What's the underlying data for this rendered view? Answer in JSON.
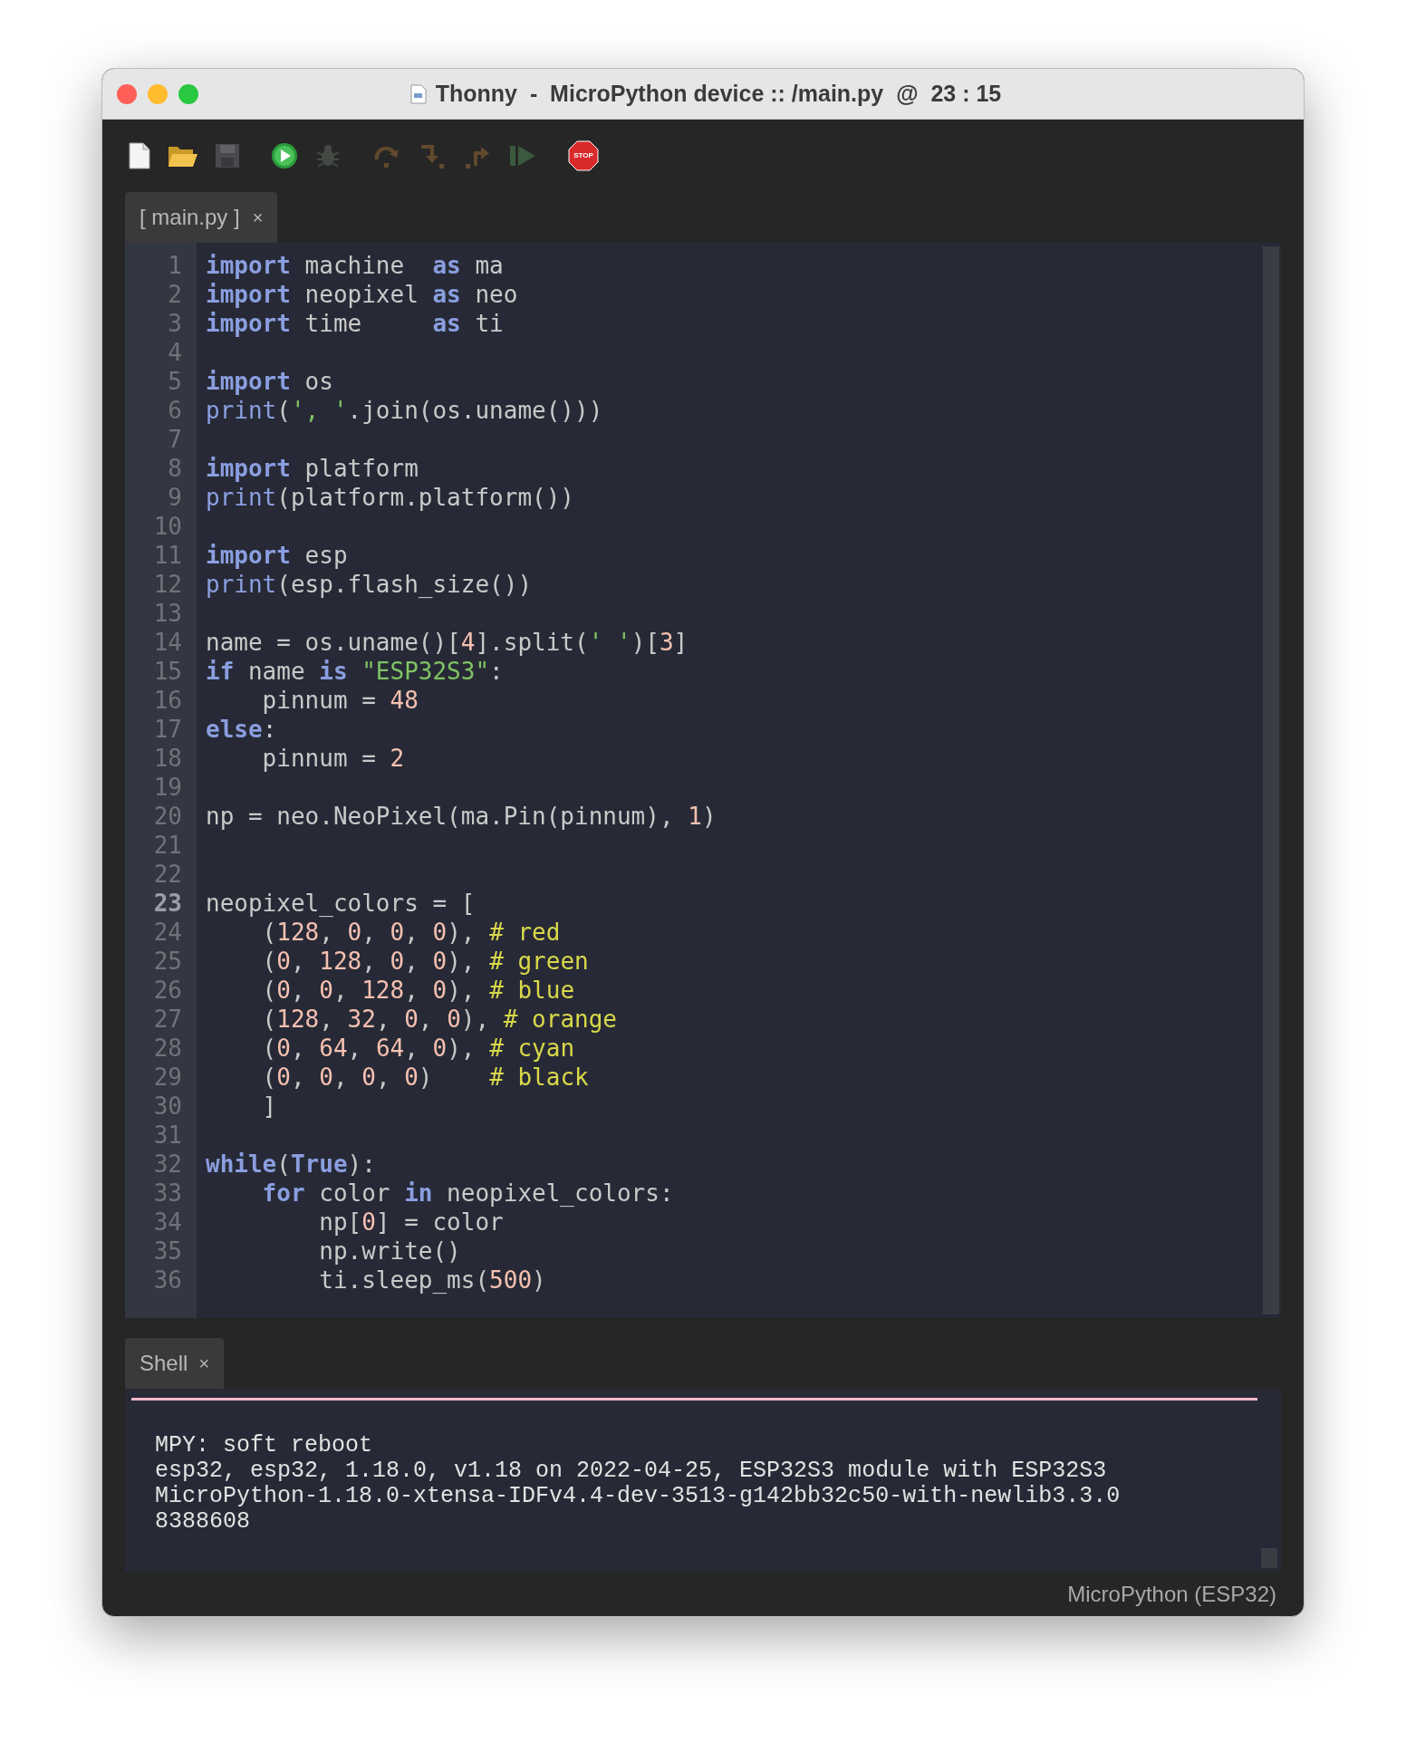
{
  "window": {
    "title": "Thonny  -  MicroPython device :: /main.py  @  23 : 15"
  },
  "toolbar": [
    {
      "kind": "new",
      "disabled": false
    },
    {
      "kind": "open",
      "disabled": false
    },
    {
      "kind": "save",
      "disabled": true
    },
    {
      "kind": "run",
      "disabled": false
    },
    {
      "kind": "debug",
      "disabled": true
    },
    {
      "kind": "step_over",
      "disabled": true
    },
    {
      "kind": "step_into",
      "disabled": true
    },
    {
      "kind": "step_out",
      "disabled": true
    },
    {
      "kind": "resume",
      "disabled": true
    },
    {
      "kind": "stop",
      "disabled": false,
      "label": "STOP"
    }
  ],
  "editor": {
    "tab": {
      "label": "[ main.py ]",
      "close": "×"
    },
    "lines": [
      {
        "number": "1",
        "current": false,
        "tokens": [
          {
            "kind": "keyword",
            "text": "import"
          },
          {
            "kind": "text",
            "text": " machine  "
          },
          {
            "kind": "keyword",
            "text": "as"
          },
          {
            "kind": "text",
            "text": " ma"
          }
        ]
      },
      {
        "number": "2",
        "current": false,
        "tokens": [
          {
            "kind": "keyword",
            "text": "import"
          },
          {
            "kind": "text",
            "text": " neopixel "
          },
          {
            "kind": "keyword",
            "text": "as"
          },
          {
            "kind": "text",
            "text": " neo"
          }
        ]
      },
      {
        "number": "3",
        "current": false,
        "tokens": [
          {
            "kind": "keyword",
            "text": "import"
          },
          {
            "kind": "text",
            "text": " time     "
          },
          {
            "kind": "keyword",
            "text": "as"
          },
          {
            "kind": "text",
            "text": " ti"
          }
        ]
      },
      {
        "number": "4",
        "current": false
      },
      {
        "number": "5",
        "current": false,
        "tokens": [
          {
            "kind": "keyword",
            "text": "import"
          },
          {
            "kind": "text",
            "text": " os"
          }
        ]
      },
      {
        "number": "6",
        "current": false,
        "tokens": [
          {
            "kind": "builtin",
            "text": "print"
          },
          {
            "kind": "text",
            "text": "("
          },
          {
            "kind": "string",
            "text": "', '"
          },
          {
            "kind": "text",
            "text": ".join(os.uname()))"
          }
        ]
      },
      {
        "number": "7",
        "current": false
      },
      {
        "number": "8",
        "current": false,
        "tokens": [
          {
            "kind": "keyword",
            "text": "import"
          },
          {
            "kind": "text",
            "text": " platform"
          }
        ]
      },
      {
        "number": "9",
        "current": false,
        "tokens": [
          {
            "kind": "builtin",
            "text": "print"
          },
          {
            "kind": "text",
            "text": "(platform.platform())"
          }
        ]
      },
      {
        "number": "10",
        "current": false
      },
      {
        "number": "11",
        "current": false,
        "tokens": [
          {
            "kind": "keyword",
            "text": "import"
          },
          {
            "kind": "text",
            "text": " esp"
          }
        ]
      },
      {
        "number": "12",
        "current": false,
        "tokens": [
          {
            "kind": "builtin",
            "text": "print"
          },
          {
            "kind": "text",
            "text": "(esp.flash_size())"
          }
        ]
      },
      {
        "number": "13",
        "current": false
      },
      {
        "number": "14",
        "current": false,
        "tokens": [
          {
            "kind": "text",
            "text": "name = os.uname()["
          },
          {
            "kind": "number",
            "text": "4"
          },
          {
            "kind": "text",
            "text": "].split("
          },
          {
            "kind": "string",
            "text": "' '"
          },
          {
            "kind": "text",
            "text": ")["
          },
          {
            "kind": "number",
            "text": "3"
          },
          {
            "kind": "text",
            "text": "]"
          }
        ]
      },
      {
        "number": "15",
        "current": false,
        "tokens": [
          {
            "kind": "keyword",
            "text": "if"
          },
          {
            "kind": "text",
            "text": " name "
          },
          {
            "kind": "keyword",
            "text": "is "
          },
          {
            "kind": "string",
            "text": "\"ESP32S3\""
          },
          {
            "kind": "text",
            "text": ":"
          }
        ]
      },
      {
        "number": "16",
        "current": false,
        "tokens": [
          {
            "kind": "text",
            "text": "    pinnum = "
          },
          {
            "kind": "number",
            "text": "48"
          }
        ]
      },
      {
        "number": "17",
        "current": false,
        "tokens": [
          {
            "kind": "keyword",
            "text": "else"
          },
          {
            "kind": "text",
            "text": ":"
          }
        ]
      },
      {
        "number": "18",
        "current": false,
        "tokens": [
          {
            "kind": "text",
            "text": "    pinnum = "
          },
          {
            "kind": "number",
            "text": "2"
          }
        ]
      },
      {
        "number": "19",
        "current": false
      },
      {
        "number": "20",
        "current": false,
        "tokens": [
          {
            "kind": "text",
            "text": "np = neo.NeoPixel(ma.Pin(pinnum), "
          },
          {
            "kind": "number",
            "text": "1"
          },
          {
            "kind": "text",
            "text": ")"
          }
        ]
      },
      {
        "number": "21",
        "current": false
      },
      {
        "number": "22",
        "current": false
      },
      {
        "number": "23",
        "current": true,
        "tokens": [
          {
            "kind": "text",
            "text": "neopixel_colors = ["
          }
        ]
      },
      {
        "number": "24",
        "current": false,
        "tokens": [
          {
            "kind": "text",
            "text": "    ("
          },
          {
            "kind": "number",
            "text": "128"
          },
          {
            "kind": "text",
            "text": ", "
          },
          {
            "kind": "number",
            "text": "0"
          },
          {
            "kind": "text",
            "text": ", "
          },
          {
            "kind": "number",
            "text": "0"
          },
          {
            "kind": "text",
            "text": ", "
          },
          {
            "kind": "number",
            "text": "0"
          },
          {
            "kind": "text",
            "text": "), "
          },
          {
            "kind": "comment",
            "text": "# red"
          }
        ]
      },
      {
        "number": "25",
        "current": false,
        "tokens": [
          {
            "kind": "text",
            "text": "    ("
          },
          {
            "kind": "number",
            "text": "0"
          },
          {
            "kind": "text",
            "text": ", "
          },
          {
            "kind": "number",
            "text": "128"
          },
          {
            "kind": "text",
            "text": ", "
          },
          {
            "kind": "number",
            "text": "0"
          },
          {
            "kind": "text",
            "text": ", "
          },
          {
            "kind": "number",
            "text": "0"
          },
          {
            "kind": "text",
            "text": "), "
          },
          {
            "kind": "comment",
            "text": "# green"
          }
        ]
      },
      {
        "number": "26",
        "current": false,
        "tokens": [
          {
            "kind": "text",
            "text": "    ("
          },
          {
            "kind": "number",
            "text": "0"
          },
          {
            "kind": "text",
            "text": ", "
          },
          {
            "kind": "number",
            "text": "0"
          },
          {
            "kind": "text",
            "text": ", "
          },
          {
            "kind": "number",
            "text": "128"
          },
          {
            "kind": "text",
            "text": ", "
          },
          {
            "kind": "number",
            "text": "0"
          },
          {
            "kind": "text",
            "text": "), "
          },
          {
            "kind": "comment",
            "text": "# blue"
          }
        ]
      },
      {
        "number": "27",
        "current": false,
        "tokens": [
          {
            "kind": "text",
            "text": "    ("
          },
          {
            "kind": "number",
            "text": "128"
          },
          {
            "kind": "text",
            "text": ", "
          },
          {
            "kind": "number",
            "text": "32"
          },
          {
            "kind": "text",
            "text": ", "
          },
          {
            "kind": "number",
            "text": "0"
          },
          {
            "kind": "text",
            "text": ", "
          },
          {
            "kind": "number",
            "text": "0"
          },
          {
            "kind": "text",
            "text": "), "
          },
          {
            "kind": "comment",
            "text": "# orange"
          }
        ]
      },
      {
        "number": "28",
        "current": false,
        "tokens": [
          {
            "kind": "text",
            "text": "    ("
          },
          {
            "kind": "number",
            "text": "0"
          },
          {
            "kind": "text",
            "text": ", "
          },
          {
            "kind": "number",
            "text": "64"
          },
          {
            "kind": "text",
            "text": ", "
          },
          {
            "kind": "number",
            "text": "64"
          },
          {
            "kind": "text",
            "text": ", "
          },
          {
            "kind": "number",
            "text": "0"
          },
          {
            "kind": "text",
            "text": "), "
          },
          {
            "kind": "comment",
            "text": "# cyan"
          }
        ]
      },
      {
        "number": "29",
        "current": false,
        "tokens": [
          {
            "kind": "text",
            "text": "    ("
          },
          {
            "kind": "number",
            "text": "0"
          },
          {
            "kind": "text",
            "text": ", "
          },
          {
            "kind": "number",
            "text": "0"
          },
          {
            "kind": "text",
            "text": ", "
          },
          {
            "kind": "number",
            "text": "0"
          },
          {
            "kind": "text",
            "text": ", "
          },
          {
            "kind": "number",
            "text": "0"
          },
          {
            "kind": "text",
            "text": ")    "
          },
          {
            "kind": "comment",
            "text": "# black"
          }
        ]
      },
      {
        "number": "30",
        "current": false,
        "tokens": [
          {
            "kind": "text",
            "text": "    ]"
          }
        ]
      },
      {
        "number": "31",
        "current": false
      },
      {
        "number": "32",
        "current": false,
        "tokens": [
          {
            "kind": "keyword",
            "text": "while"
          },
          {
            "kind": "text",
            "text": "("
          },
          {
            "kind": "keyword",
            "text": "True"
          },
          {
            "kind": "text",
            "text": "):"
          }
        ]
      },
      {
        "number": "33",
        "current": false,
        "tokens": [
          {
            "kind": "keyword",
            "text": "    for"
          },
          {
            "kind": "text",
            "text": " color "
          },
          {
            "kind": "keyword",
            "text": "in"
          },
          {
            "kind": "text",
            "text": " neopixel_colors:"
          }
        ]
      },
      {
        "number": "34",
        "current": false,
        "tokens": [
          {
            "kind": "text",
            "text": "        np["
          },
          {
            "kind": "number",
            "text": "0"
          },
          {
            "kind": "text",
            "text": "] = color"
          }
        ]
      },
      {
        "number": "35",
        "current": false,
        "tokens": [
          {
            "kind": "text",
            "text": "        np.write()"
          }
        ]
      },
      {
        "number": "36",
        "current": false,
        "tokens": [
          {
            "kind": "text",
            "text": "        ti.sleep_ms("
          },
          {
            "kind": "number",
            "text": "500"
          },
          {
            "kind": "text",
            "text": ")"
          }
        ]
      }
    ]
  },
  "shell": {
    "tab": {
      "label": "Shell",
      "close": "×"
    },
    "lines": [
      "MPY: soft reboot",
      "esp32, esp32, 1.18.0, v1.18 on 2022-04-25, ESP32S3 module with ESP32S3",
      "MicroPython-1.18.0-xtensa-IDFv4.4-dev-3513-g142bb32c50-with-newlib3.3.0",
      "8388608"
    ]
  },
  "status_bar": {
    "interpreter": "MicroPython (ESP32)"
  }
}
